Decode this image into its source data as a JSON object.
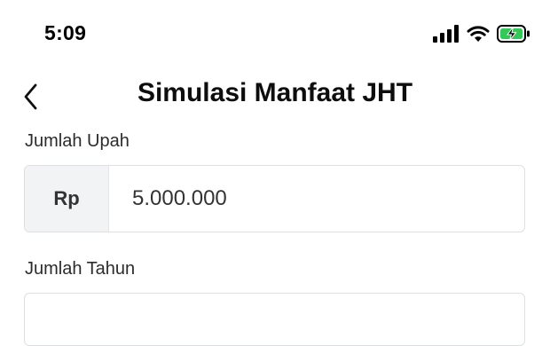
{
  "status_bar": {
    "time": "5:09",
    "icons": [
      "signal-icon",
      "wifi-icon",
      "battery-charging-icon"
    ],
    "battery_color": "#34c759"
  },
  "nav": {
    "back_icon": "chevron-left-icon",
    "title": "Simulasi Manfaat JHT"
  },
  "form": {
    "upah": {
      "label": "Jumlah Upah",
      "prefix": "Rp",
      "value": "5.000.000"
    },
    "tahun": {
      "label": "Jumlah Tahun",
      "value": ""
    }
  }
}
